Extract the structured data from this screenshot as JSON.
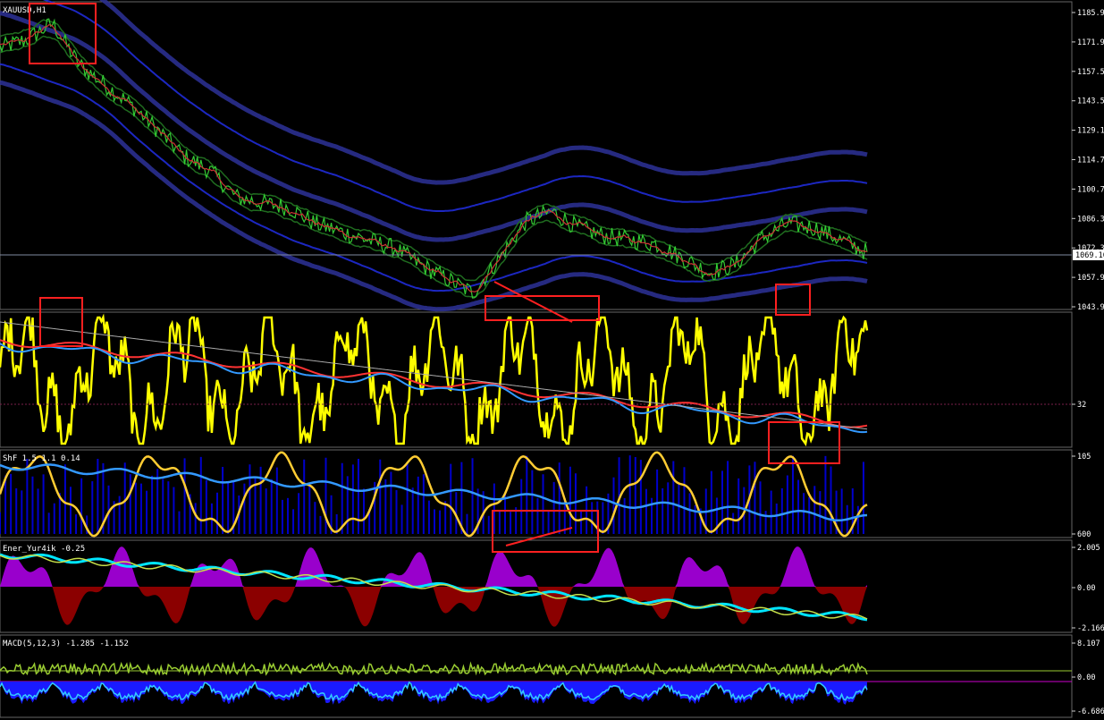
{
  "window": {
    "title_label": "XAUUSD,H1",
    "price_readout": "1069.10"
  },
  "chart_data": [
    {
      "panel": "main",
      "type": "line",
      "label": "XAUUSD,H1",
      "y_ticks": [
        "1185.90",
        "1171.90",
        "1157.50",
        "1143.50",
        "1129.10",
        "1114.70",
        "1100.70",
        "1086.30",
        "1072.30",
        "1057.90",
        "1043.90"
      ],
      "current_price": "1069.10",
      "series_colors": {
        "price": "#33cc33",
        "ma": "#cc3333",
        "bands": "#2a2f8f",
        "bands_inner": "#1f2bd6",
        "envelope": "#1f6b1f"
      },
      "trend": [
        1168,
        1172,
        1180,
        1160,
        1150,
        1140,
        1128,
        1115,
        1108,
        1095,
        1092,
        1090,
        1082,
        1078,
        1074,
        1070,
        1062,
        1055,
        1048,
        1065,
        1083,
        1088,
        1080,
        1076,
        1074,
        1072,
        1065,
        1058,
        1062,
        1075,
        1082,
        1080,
        1074,
        1068
      ]
    },
    {
      "panel": "oscillator_1",
      "type": "line",
      "y_ticks": [
        "32"
      ],
      "series_colors": {
        "osc": "#ffff00",
        "fast": "#ff3333",
        "slow": "#3399ff",
        "mid": "#6699cc",
        "smooth": "#aaaaaa"
      },
      "reference_value": 32
    },
    {
      "panel": "oscillator_2",
      "type": "line",
      "label": "ShF 1.5 1.1 0.14",
      "y_ticks": [
        "105",
        "600"
      ],
      "series_colors": {
        "histo": "#0000cc",
        "osc": "#ffcc33",
        "mid": "#3399ff"
      }
    },
    {
      "panel": "oscillator_3",
      "type": "area",
      "label": "Ener_Yur4ik -0.25",
      "y_ticks": [
        "2.005",
        "0.00",
        "-2.166"
      ],
      "series_colors": {
        "pos": "#9900cc",
        "neg": "#8b0000",
        "line_a": "#00e5ff",
        "line_b": "#c6e04a"
      }
    },
    {
      "panel": "macd",
      "type": "area",
      "label": "MACD(5,12,3) -1.285 -1.152",
      "y_ticks": [
        "8.107",
        "0.00",
        "-6.686"
      ],
      "series_colors": {
        "hist": "#1a1aff",
        "signal": "#9acd32",
        "line": "#33ccff",
        "level": "#cc00cc"
      }
    }
  ]
}
